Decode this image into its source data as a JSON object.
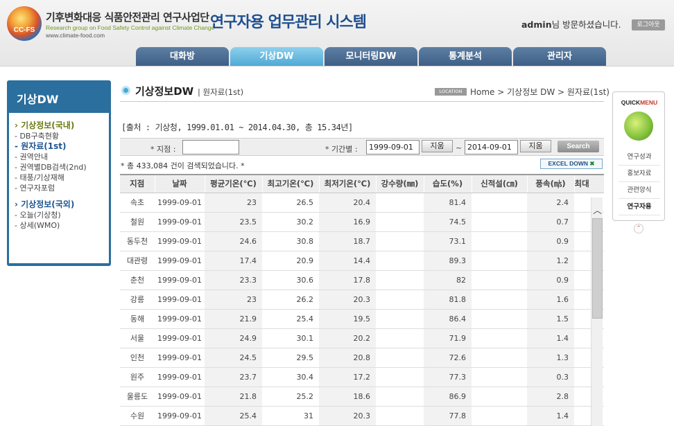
{
  "header": {
    "logo_text": "CC-FS",
    "org_title": "기후변화대응 식품안전관리 연구사업단",
    "org_subtitle": "Research group on Food Safety Control against Climate Change",
    "org_url": "www.climate-food.com",
    "system_title": "연구자용 업무관리 시스템",
    "user": "admin",
    "welcome_suffix": "님 방문하셨습니다.",
    "logout_label": "로그아웃"
  },
  "nav": {
    "tabs": [
      {
        "label": "대화방",
        "active": false
      },
      {
        "label": "기상DW",
        "active": true
      },
      {
        "label": "모니터링DW",
        "active": false
      },
      {
        "label": "통계분석",
        "active": false
      },
      {
        "label": "관리자",
        "active": false
      }
    ]
  },
  "sidebar": {
    "title": "기상DW",
    "cat1": "› 기상정보(국내)",
    "item_db": "- DB구축현황",
    "item_raw": "- 원자료(1st)",
    "item_region": "- 권역안내",
    "item_regional_db": "- 권역별DB검색(2nd)",
    "item_typhoon": "- 태풍/기상재해",
    "item_forum": "- 연구자포럼",
    "cat2": "› 기상정보(국외)",
    "item_today": "- 오늘(기상청)",
    "item_wmo": "- 상세(WMO)"
  },
  "page": {
    "title": "기상정보DW",
    "subtitle": "| 원자료(1st)",
    "location_badge": "LOCATION",
    "breadcrumb": "Home > 기상정보 DW > 원자료(1st)"
  },
  "source_text": "[출처 : 기상청, 1999.01.01 ~ 2014.04.30, 총 15.34년]",
  "filter": {
    "station_label": "* 지점 :",
    "station_value": "",
    "period_label": "* 기간별 :",
    "start_date": "1999-09-01",
    "clear_label": "지움",
    "tilde": "~",
    "end_date": "2014-09-01",
    "search_label": "Search"
  },
  "result_count": "* 총 433,084 건이 검색되었습니다. *",
  "excel_label": "EXCEL DOWN",
  "table": {
    "headers": [
      "지점",
      "날짜",
      "평균기온(℃)",
      "최고기온(℃)",
      "최저기온(℃)",
      "강수량(㎜)",
      "습도(%)",
      "신적설(㎝)",
      "풍속(㎧)",
      "최대"
    ],
    "rows": [
      [
        "속초",
        "1999-09-01",
        "23",
        "26.5",
        "20.4",
        "",
        "81.4",
        "",
        "2.4"
      ],
      [
        "철원",
        "1999-09-01",
        "23.5",
        "30.2",
        "16.9",
        "",
        "74.5",
        "",
        "0.7"
      ],
      [
        "동두천",
        "1999-09-01",
        "24.6",
        "30.8",
        "18.7",
        "",
        "73.1",
        "",
        "0.9"
      ],
      [
        "대관령",
        "1999-09-01",
        "17.4",
        "20.9",
        "14.4",
        "",
        "89.3",
        "",
        "1.2"
      ],
      [
        "춘천",
        "1999-09-01",
        "23.3",
        "30.6",
        "17.8",
        "",
        "82",
        "",
        "0.9"
      ],
      [
        "강릉",
        "1999-09-01",
        "23",
        "26.2",
        "20.3",
        "",
        "81.8",
        "",
        "1.6"
      ],
      [
        "동해",
        "1999-09-01",
        "21.9",
        "25.4",
        "19.5",
        "",
        "86.4",
        "",
        "1.5"
      ],
      [
        "서울",
        "1999-09-01",
        "24.9",
        "30.1",
        "20.2",
        "",
        "71.9",
        "",
        "1.4"
      ],
      [
        "인천",
        "1999-09-01",
        "24.5",
        "29.5",
        "20.8",
        "",
        "72.6",
        "",
        "1.3"
      ],
      [
        "원주",
        "1999-09-01",
        "23.7",
        "30.4",
        "17.2",
        "",
        "77.3",
        "",
        "0.3"
      ],
      [
        "울릉도",
        "1999-09-01",
        "21.8",
        "25.2",
        "18.6",
        "",
        "86.9",
        "",
        "2.8"
      ],
      [
        "수원",
        "1999-09-01",
        "25.4",
        "31",
        "20.3",
        "",
        "77.8",
        "",
        "1.4"
      ]
    ]
  },
  "quick_menu": {
    "title_a": "QUICK",
    "title_b": "MENU",
    "items": [
      {
        "label": "연구성과",
        "active": false
      },
      {
        "label": "홍보자료",
        "active": false
      },
      {
        "label": "관련양식",
        "active": false
      },
      {
        "label": "연구자용",
        "active": true
      }
    ]
  },
  "colors": {
    "nav_tab": "#4a6b91",
    "nav_tab_active": "#62b6e0",
    "sidebar": "#2a6f9e",
    "system_title": "#1f4f8f"
  }
}
